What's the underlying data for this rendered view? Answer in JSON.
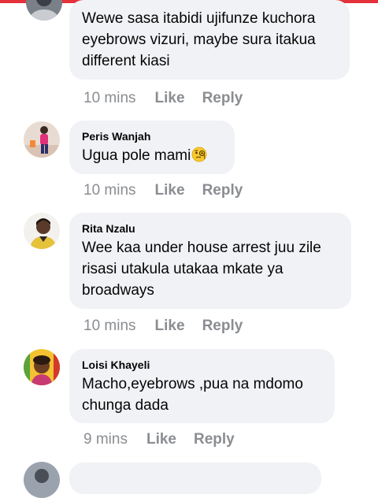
{
  "comments": [
    {
      "author": "",
      "lines": [
        "Wewe sasa itabidi ujifunze kuchora",
        "eyebrows vizuri, maybe sura itakua",
        "different kiasi"
      ],
      "time": "10 mins",
      "like_label": "Like",
      "reply_label": "Reply"
    },
    {
      "author": "Peris Wanjah",
      "lines": [
        "Ugua pole mami"
      ],
      "emoji": "face-with-monocle-icon",
      "time": "10 mins",
      "like_label": "Like",
      "reply_label": "Reply"
    },
    {
      "author": "Rita Nzalu",
      "lines": [
        "Wee kaa under house arrest juu zile",
        "risasi utakula utakaa mkate ya",
        "broadways"
      ],
      "time": "10 mins",
      "like_label": "Like",
      "reply_label": "Reply"
    },
    {
      "author": "Loisi Khayeli",
      "lines": [
        "Macho,eyebrows ,pua na mdomo",
        "chunga dada"
      ],
      "time": "9 mins",
      "like_label": "Like",
      "reply_label": "Reply"
    }
  ],
  "colors": {
    "accent_bar": "#e4313a",
    "bubble": "#f0f2f5",
    "meta_text": "#8a8d91"
  }
}
